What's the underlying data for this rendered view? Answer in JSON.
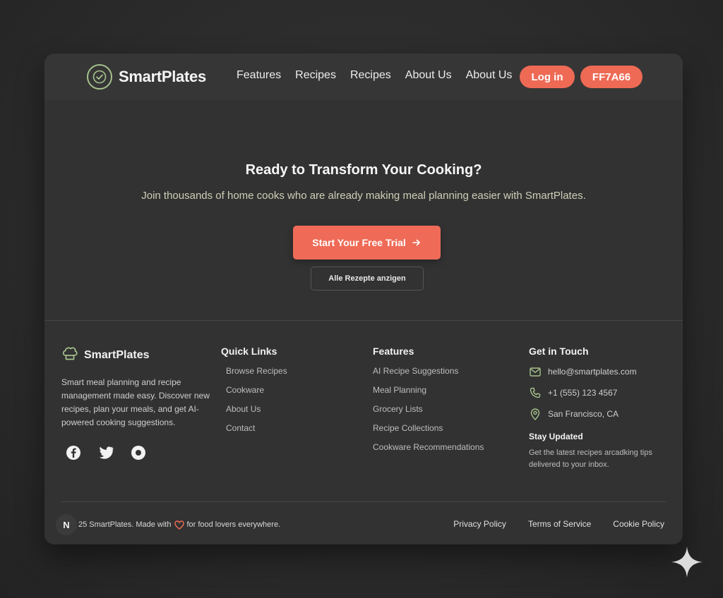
{
  "navbar": {
    "brand": "SmartPlates",
    "links": [
      "Features",
      "Recipes",
      "Recipes",
      "About Us",
      "About Us"
    ],
    "login_label": "Log in",
    "brand_button_label": "FF7A66"
  },
  "hero": {
    "title": "Ready to Transform Your Cooking?",
    "subtitle": "Join thousands of home cooks who are already making meal planning easier with SmartPlates.",
    "cta_label": "Start Your Free Trial",
    "secondary_label": "Alle Rezepte anzigen"
  },
  "footer": {
    "brand": "SmartPlates",
    "description": "Smart meal planning and recipe management made easy. Discover new recipes, plan your meals, and get AI-powered cooking suggestions.",
    "quick_links": {
      "title": "Quick Links",
      "items": [
        "Browse Recipes",
        "Cookware",
        "About Us",
        "Contact"
      ]
    },
    "features": {
      "title": "Features",
      "items": [
        "AI Recipe Suggestions",
        "Meal Planning",
        "Grocery Lists",
        "Recipe Collections",
        "Cookware Recommendations"
      ]
    },
    "contact": {
      "title": "Get in Touch",
      "email": "hello@smartplates.com",
      "phone": "+1 (555) 123 4567",
      "location": "San Francisco, CA",
      "stay_title": "Stay Updated",
      "stay_desc": "Get the latest recipes arcadking tips delivered to your inbox."
    },
    "bottom": {
      "badge": "N",
      "copyright_pre": "25 SmartPlates. Made with",
      "copyright_post": "for food lovers everywhere.",
      "legal": [
        "Privacy Policy",
        "Terms of Service",
        "Cookie Policy"
      ]
    }
  },
  "icons": {
    "logo": "check-circle-icon",
    "footer_logo": "chef-hat-icon",
    "social": [
      "facebook-icon",
      "twitter-icon",
      "social-dot-icon"
    ],
    "contact": [
      "mail-icon",
      "phone-icon",
      "map-pin-icon"
    ],
    "heart": "heart-icon",
    "cta_arrow": "arrow-right-icon",
    "corner": "sparkle-icon"
  },
  "colors": {
    "accent": "#ee6a55",
    "logo_green": "#a6c28c",
    "background": "#2b2b2b",
    "panel": "#323232"
  }
}
